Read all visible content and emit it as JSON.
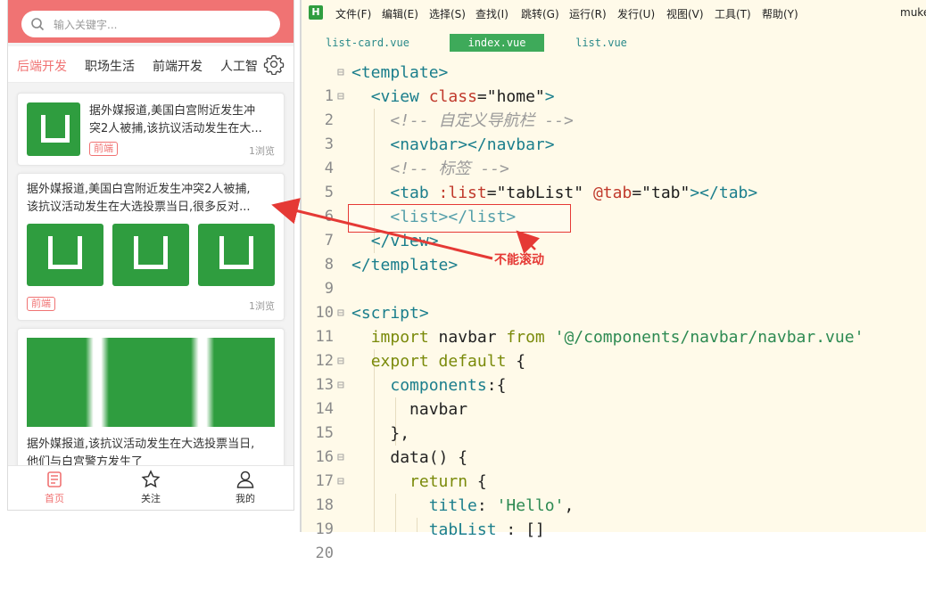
{
  "phone": {
    "search_placeholder": "输入关键字...",
    "tabs": [
      "后端开发",
      "职场生活",
      "前端开发",
      "人工智"
    ],
    "cards": [
      {
        "title": "据外媒报道,美国白宫附近发生冲突2人被捕,该抗议活动发生在大...",
        "title_line1": "据外媒报道,美国白宫附近发生冲",
        "title_line2": "突2人被捕,该抗议活动发生在大...",
        "tag": "前端",
        "views": "1浏览"
      },
      {
        "title_line1": "据外媒报道,美国白宫附近发生冲突2人被捕,",
        "title_line2": "该抗议活动发生在大选投票当日,很多反对...",
        "tag": "前端",
        "views": "1浏览"
      },
      {
        "title_line1": "据外媒报道,该抗议活动发生在大选投票当日,",
        "title_line2": "他们与白宫警方发生了"
      }
    ],
    "nav": [
      {
        "label": "首页",
        "icon": "home-icon"
      },
      {
        "label": "关注",
        "icon": "star-icon"
      },
      {
        "label": "我的",
        "icon": "user-icon"
      }
    ],
    "colors": {
      "accent": "#f07373",
      "logo_green": "#2f9d3f"
    }
  },
  "editor": {
    "app_logo": "H",
    "menu": [
      "文件(F)",
      "编辑(E)",
      "选择(S)",
      "查找(I)",
      "跳转(G)",
      "运行(R)",
      "发行(U)",
      "视图(V)",
      "工具(T)",
      "帮助(Y)"
    ],
    "user": "muke",
    "file_tabs": [
      "list-card.vue",
      "index.vue",
      "list.vue"
    ],
    "active_tab": "index.vue",
    "annotation": "不能滚动",
    "line_numbers": [
      "1",
      "2",
      "3",
      "4",
      "5",
      "6",
      "7",
      "8",
      "9",
      "10",
      "11",
      "12",
      "13",
      "14",
      "15",
      "16",
      "17",
      "18",
      "19",
      "20"
    ],
    "code": {
      "l1": "<template>",
      "l2a": "<view ",
      "l2b": "class",
      "l2c": "=",
      "l2d": "\"home\"",
      "l2e": ">",
      "l3": "<!-- 自定义导航栏 -->",
      "l4": "<navbar></navbar>",
      "l5": "<!-- 标签 -->",
      "l6a": "<tab ",
      "l6b": ":list",
      "l6c": "=",
      "l6d": "\"tabList\"",
      "l6e": " @tab",
      "l6f": "=",
      "l6g": "\"tab\"",
      "l6h": "></tab>",
      "l7": "<list></list>",
      "l8": "</view>",
      "l9": "</template>",
      "l11": "<script>",
      "l12a": "import",
      "l12b": " navbar ",
      "l12c": "from",
      "l12d": " '@/components/navbar/navbar.vue'",
      "l13a": "export default",
      "l13b": " {",
      "l14a": "components",
      "l14b": ":{",
      "l15": "navbar",
      "l16": "},",
      "l17a": "data",
      "l17b": "() {",
      "l18a": "return",
      "l18b": " {",
      "l19a": "title",
      "l19b": ": ",
      "l19c": "'Hello'",
      "l19d": ",",
      "l20a": "tabList",
      "l20b": " : []"
    }
  }
}
